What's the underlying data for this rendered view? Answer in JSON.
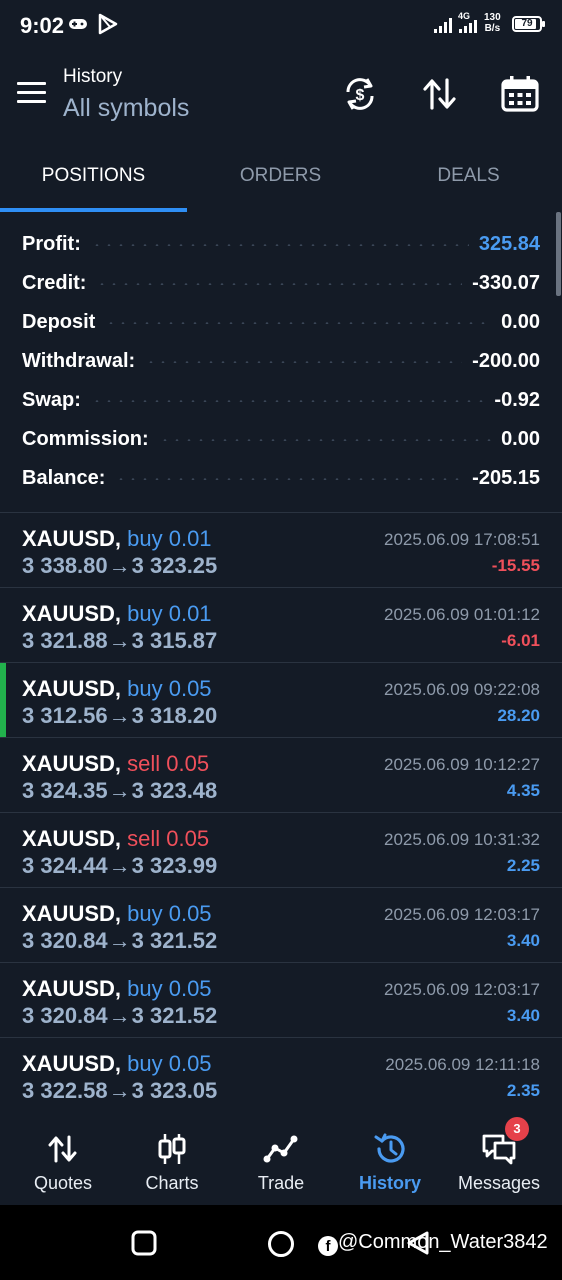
{
  "status_bar": {
    "time": "9:02",
    "network": "4G",
    "net_speed_value": "130",
    "net_speed_unit": "B/s",
    "battery": "79"
  },
  "header": {
    "title": "History",
    "subtitle": "All symbols"
  },
  "tabs": [
    {
      "label": "POSITIONS",
      "active": true
    },
    {
      "label": "ORDERS",
      "active": false
    },
    {
      "label": "DEALS",
      "active": false
    }
  ],
  "summary": [
    {
      "label": "Profit:",
      "value": "325.84",
      "accent": "blue"
    },
    {
      "label": "Credit:",
      "value": "-330.07"
    },
    {
      "label": "Deposit",
      "value": "0.00"
    },
    {
      "label": "Withdrawal:",
      "value": "-200.00"
    },
    {
      "label": "Swap:",
      "value": "-0.92"
    },
    {
      "label": "Commission:",
      "value": "0.00"
    },
    {
      "label": "Balance:",
      "value": "-205.15"
    }
  ],
  "deals": [
    {
      "symbol": "XAUUSD,",
      "side": "buy 0.01",
      "type": "buy",
      "open": "3 338.80",
      "arrow": "→",
      "close": "3 323.25",
      "time": "2025.06.09 17:08:51",
      "profit": "-15.55",
      "negative": true
    },
    {
      "symbol": "XAUUSD,",
      "side": "buy 0.01",
      "type": "buy",
      "open": "3 321.88",
      "arrow": "→",
      "close": "3 315.87",
      "time": "2025.06.09 01:01:12",
      "profit": "-6.01",
      "negative": true
    },
    {
      "symbol": "XAUUSD,",
      "side": "buy 0.05",
      "type": "buy",
      "open": "3 312.56",
      "arrow": "→",
      "close": "3 318.20",
      "time": "2025.06.09 09:22:08",
      "profit": "28.20",
      "negative": false,
      "highlight": true
    },
    {
      "symbol": "XAUUSD,",
      "side": "sell 0.05",
      "type": "sell",
      "open": "3 324.35",
      "arrow": "→",
      "close": "3 323.48",
      "time": "2025.06.09 10:12:27",
      "profit": "4.35",
      "negative": false
    },
    {
      "symbol": "XAUUSD,",
      "side": "sell 0.05",
      "type": "sell",
      "open": "3 324.44",
      "arrow": "→",
      "close": "3 323.99",
      "time": "2025.06.09 10:31:32",
      "profit": "2.25",
      "negative": false
    },
    {
      "symbol": "XAUUSD,",
      "side": "buy 0.05",
      "type": "buy",
      "open": "3 320.84",
      "arrow": "→",
      "close": "3 321.52",
      "time": "2025.06.09 12:03:17",
      "profit": "3.40",
      "negative": false
    },
    {
      "symbol": "XAUUSD,",
      "side": "buy 0.05",
      "type": "buy",
      "open": "3 320.84",
      "arrow": "→",
      "close": "3 321.52",
      "time": "2025.06.09 12:03:17",
      "profit": "3.40",
      "negative": false
    },
    {
      "symbol": "XAUUSD,",
      "side": "buy 0.05",
      "type": "buy",
      "open": "3 322.58",
      "arrow": "→",
      "close": "3 323.05",
      "time": "2025.06.09 12:11:18",
      "profit": "2.35",
      "negative": false
    }
  ],
  "bottom_nav": [
    {
      "label": "Quotes",
      "icon": "quotes-arrows-icon"
    },
    {
      "label": "Charts",
      "icon": "candlestick-icon"
    },
    {
      "label": "Trade",
      "icon": "trade-line-icon"
    },
    {
      "label": "History",
      "icon": "history-clock-icon",
      "active": true
    },
    {
      "label": "Messages",
      "icon": "chat-bubbles-icon",
      "badge": "3"
    }
  ],
  "watermark": "@Common_Water3842",
  "colors": {
    "background": "#141b26",
    "accent_blue": "#4a9bf1",
    "loss_red": "#f0505b",
    "highlight_green": "#22b14c"
  }
}
